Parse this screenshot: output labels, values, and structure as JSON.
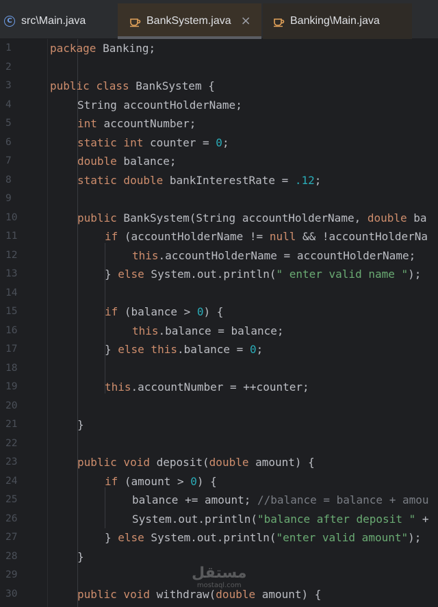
{
  "tabs": [
    {
      "label": "src\\Main.java",
      "icon": "class-c-icon",
      "active": false
    },
    {
      "label": "BankSystem.java",
      "icon": "java-cup-icon",
      "active": true,
      "close": "×"
    },
    {
      "label": "Banking\\Main.java",
      "icon": "java-cup-icon",
      "active": false
    }
  ],
  "colors": {
    "background": "#1e1f22",
    "keyword": "#cf8e6d",
    "number": "#2aacb8",
    "string": "#6aab73",
    "field": "#c77dbb",
    "comment": "#7a7e85"
  },
  "lines": [
    {
      "n": "1",
      "indent": 0,
      "tokens": [
        [
          "kw",
          "package"
        ],
        [
          "t",
          " Banking;"
        ]
      ]
    },
    {
      "n": "2",
      "indent": 0,
      "tokens": []
    },
    {
      "n": "3",
      "indent": 0,
      "tokens": [
        [
          "kw",
          "public"
        ],
        [
          "t",
          " "
        ],
        [
          "kw",
          "class"
        ],
        [
          "t",
          " BankSystem {"
        ]
      ]
    },
    {
      "n": "4",
      "indent": 1,
      "tokens": [
        [
          "t",
          "String accountHolderName;"
        ]
      ]
    },
    {
      "n": "5",
      "indent": 1,
      "tokens": [
        [
          "kw",
          "int"
        ],
        [
          "t",
          " accountNumber;"
        ]
      ]
    },
    {
      "n": "6",
      "indent": 1,
      "tokens": [
        [
          "kw",
          "static int"
        ],
        [
          "t",
          " counter = "
        ],
        [
          "num",
          "0"
        ],
        [
          "t",
          ";"
        ]
      ]
    },
    {
      "n": "7",
      "indent": 1,
      "tokens": [
        [
          "kw",
          "double"
        ],
        [
          "t",
          " balance;"
        ]
      ]
    },
    {
      "n": "8",
      "indent": 1,
      "tokens": [
        [
          "kw",
          "static double"
        ],
        [
          "t",
          " bankInterestRate = "
        ],
        [
          "num",
          ".12"
        ],
        [
          "t",
          ";"
        ]
      ]
    },
    {
      "n": "9",
      "indent": 0,
      "tokens": []
    },
    {
      "n": "10",
      "indent": 1,
      "tokens": [
        [
          "kw",
          "public"
        ],
        [
          "t",
          " BankSystem(String accountHolderName, "
        ],
        [
          "kw",
          "double"
        ],
        [
          "t",
          " ba"
        ]
      ]
    },
    {
      "n": "11",
      "indent": 2,
      "tokens": [
        [
          "kw",
          "if"
        ],
        [
          "t",
          " (accountHolderName != "
        ],
        [
          "kw",
          "null"
        ],
        [
          "t",
          " && !accountHolderNa"
        ]
      ]
    },
    {
      "n": "12",
      "indent": 3,
      "tokens": [
        [
          "kw",
          "this"
        ],
        [
          "t",
          ".accountHolderName = accountHolderName;"
        ]
      ]
    },
    {
      "n": "13",
      "indent": 2,
      "tokens": [
        [
          "t",
          "} "
        ],
        [
          "kw",
          "else"
        ],
        [
          "t",
          " System."
        ],
        [
          "t",
          "out"
        ],
        [
          "t",
          ".println("
        ],
        [
          "str",
          "\" enter valid name \""
        ],
        [
          "t",
          ");"
        ]
      ]
    },
    {
      "n": "14",
      "indent": 0,
      "tokens": []
    },
    {
      "n": "15",
      "indent": 2,
      "tokens": [
        [
          "kw",
          "if"
        ],
        [
          "t",
          " (balance > "
        ],
        [
          "num",
          "0"
        ],
        [
          "t",
          ") {"
        ]
      ]
    },
    {
      "n": "16",
      "indent": 3,
      "tokens": [
        [
          "kw",
          "this"
        ],
        [
          "t",
          ".balance = balance;"
        ]
      ]
    },
    {
      "n": "17",
      "indent": 2,
      "tokens": [
        [
          "t",
          "} "
        ],
        [
          "kw",
          "else this"
        ],
        [
          "t",
          ".balance = "
        ],
        [
          "num",
          "0"
        ],
        [
          "t",
          ";"
        ]
      ]
    },
    {
      "n": "18",
      "indent": 0,
      "tokens": []
    },
    {
      "n": "19",
      "indent": 2,
      "tokens": [
        [
          "kw",
          "this"
        ],
        [
          "t",
          ".accountNumber = ++counter;"
        ]
      ]
    },
    {
      "n": "20",
      "indent": 0,
      "tokens": []
    },
    {
      "n": "21",
      "indent": 1,
      "tokens": [
        [
          "t",
          "}"
        ]
      ]
    },
    {
      "n": "22",
      "indent": 0,
      "tokens": []
    },
    {
      "n": "23",
      "indent": 1,
      "tokens": [
        [
          "kw",
          "public void"
        ],
        [
          "t",
          " deposit("
        ],
        [
          "kw",
          "double"
        ],
        [
          "t",
          " amount) {"
        ]
      ]
    },
    {
      "n": "24",
      "indent": 2,
      "tokens": [
        [
          "kw",
          "if"
        ],
        [
          "t",
          " (amount > "
        ],
        [
          "num",
          "0"
        ],
        [
          "t",
          ") {"
        ]
      ]
    },
    {
      "n": "25",
      "indent": 3,
      "tokens": [
        [
          "t",
          "balance += amount; "
        ],
        [
          "cmt",
          "//balance = balance + amou"
        ]
      ]
    },
    {
      "n": "26",
      "indent": 3,
      "tokens": [
        [
          "t",
          "System.out.println("
        ],
        [
          "str",
          "\"balance after deposit \""
        ],
        [
          "t",
          " +"
        ]
      ]
    },
    {
      "n": "27",
      "indent": 2,
      "tokens": [
        [
          "t",
          "} "
        ],
        [
          "kw",
          "else"
        ],
        [
          "t",
          " System.out.println("
        ],
        [
          "str",
          "\"enter valid amount\""
        ],
        [
          "t",
          ");"
        ]
      ]
    },
    {
      "n": "28",
      "indent": 1,
      "tokens": [
        [
          "t",
          "}"
        ]
      ]
    },
    {
      "n": "29",
      "indent": 0,
      "tokens": []
    },
    {
      "n": "30",
      "indent": 1,
      "tokens": [
        [
          "kw",
          "public void"
        ],
        [
          "t",
          " withdraw("
        ],
        [
          "kw",
          "double"
        ],
        [
          "t",
          " amount) {"
        ]
      ]
    }
  ],
  "watermark": {
    "arabic": "مستقل",
    "latin": "mostaql.com"
  }
}
